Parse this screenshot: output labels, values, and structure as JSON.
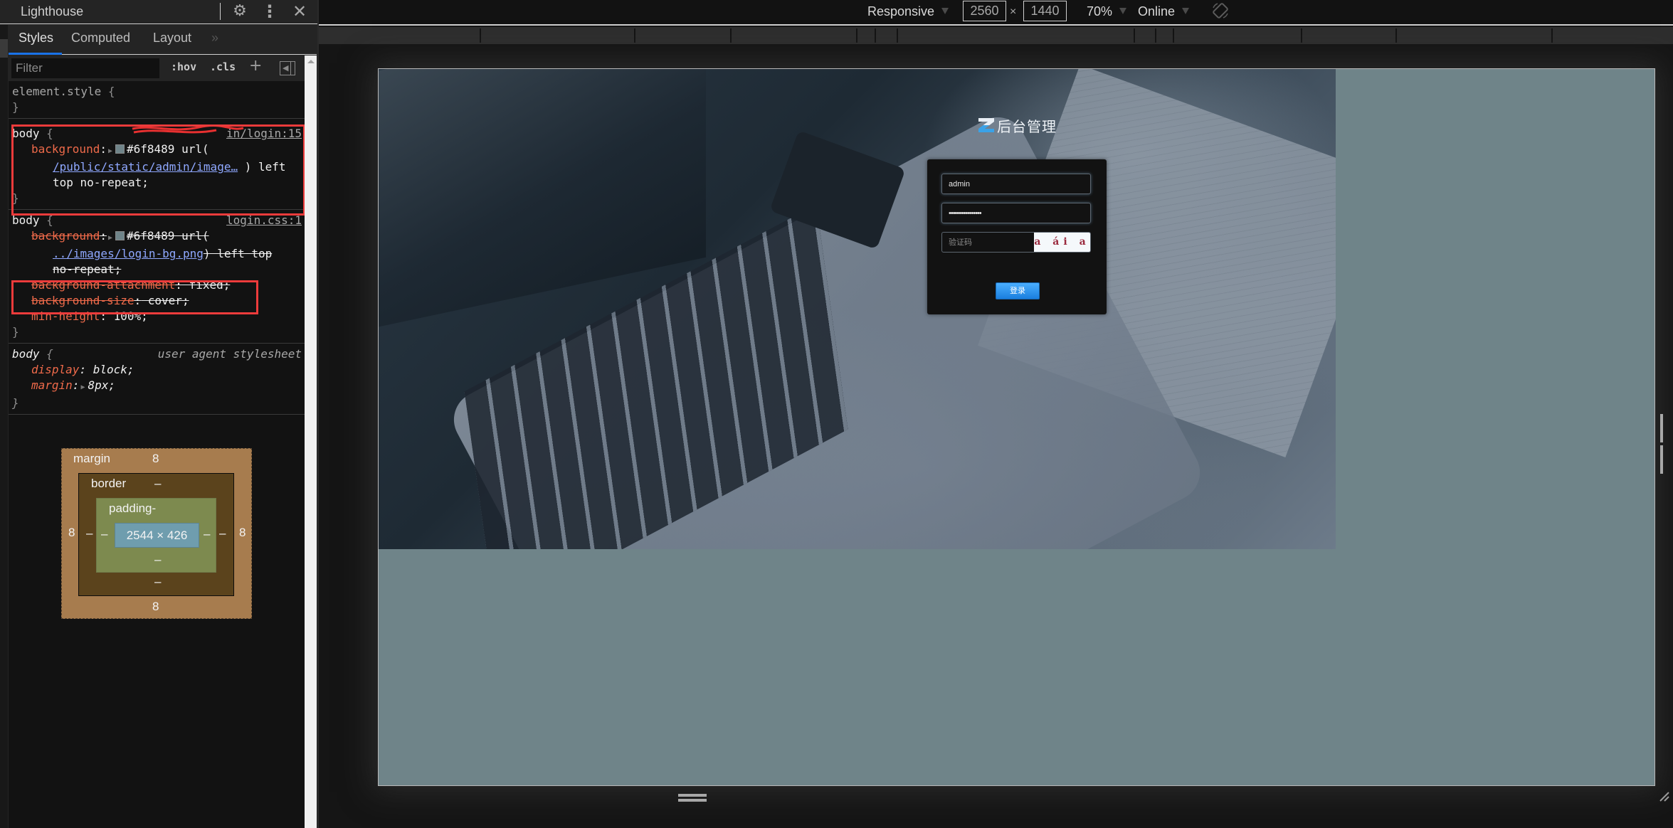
{
  "devtools": {
    "panel_title": "Lighthouse",
    "header_icons": [
      "gear-icon",
      "kebab-menu-icon",
      "close-icon"
    ],
    "tabs": [
      {
        "label": "Styles",
        "active": true
      },
      {
        "label": "Computed",
        "active": false
      },
      {
        "label": "Layout",
        "active": false
      },
      {
        "label": "»",
        "active": false
      }
    ],
    "filter": {
      "placeholder": "Filter",
      "value": ""
    },
    "filter_buttons": {
      "hov": ":hov",
      "cls": ".cls",
      "add": "+"
    },
    "rules": [
      {
        "selector": "element.style",
        "open": "{",
        "close": "}",
        "source": "",
        "declarations": []
      },
      {
        "selector": "body",
        "open": "{",
        "close": "}",
        "source": "in/login:15",
        "source_redacted": true,
        "highlighted": true,
        "declarations": [
          {
            "prop": "background",
            "colon": ":",
            "swatch": "#6f8489",
            "value_pre": "#6f8489 url(",
            "link": "/public/static/admin/image…",
            "value_post": " ) left",
            "value_cont": "top no-repeat;",
            "strike": false
          }
        ]
      },
      {
        "selector": "body",
        "open": "{",
        "close": "}",
        "source": "login.css:1",
        "declarations": [
          {
            "prop": "background",
            "colon": ":",
            "swatch": "#6f8489",
            "value_pre": "#6f8489 url(",
            "link": "../images/login-bg.png",
            "value_post": ") left top",
            "value_cont": "no-repeat;",
            "strike": true
          },
          {
            "prop": "background-attachment",
            "colon": ":",
            "value": " fixed;",
            "strike": true,
            "highlighted": true
          },
          {
            "prop": "background-size",
            "colon": ":",
            "value": " cover;",
            "strike": true,
            "highlighted": true
          },
          {
            "prop": "min-height",
            "colon": ":",
            "value": " 100%;",
            "strike": false
          }
        ]
      },
      {
        "selector": "body",
        "open": "{",
        "close": "}",
        "source": "user agent stylesheet",
        "declarations": [
          {
            "prop": "display",
            "colon": ":",
            "value": " block;"
          },
          {
            "prop": "margin",
            "colon": ":",
            "value": "8px;"
          }
        ]
      }
    ],
    "box_model": {
      "margin_label": "margin",
      "border_label": "border",
      "padding_label": "padding-",
      "margin": {
        "top": "8",
        "right": "8",
        "bottom": "8",
        "left": "8"
      },
      "border": {
        "top": "–",
        "right": "–",
        "bottom": "–",
        "left": "–"
      },
      "padding": {
        "right": "–",
        "bottom": "–",
        "left": "–"
      },
      "content": "2544 × 426"
    }
  },
  "device_toolbar": {
    "device": "Responsive",
    "width": "2560",
    "times": "×",
    "height": "1440",
    "zoom": "70%",
    "throttling": "Online",
    "rotate_icon": "rotate-icon"
  },
  "page": {
    "background_color": "#6f8489",
    "logo_letter": "Z",
    "logo_text": "后台管理",
    "login": {
      "username": "admin",
      "password": "••••••••••••••••",
      "captcha_placeholder": "验证码",
      "captcha_text": "a ái a",
      "submit_label": "登录"
    }
  }
}
